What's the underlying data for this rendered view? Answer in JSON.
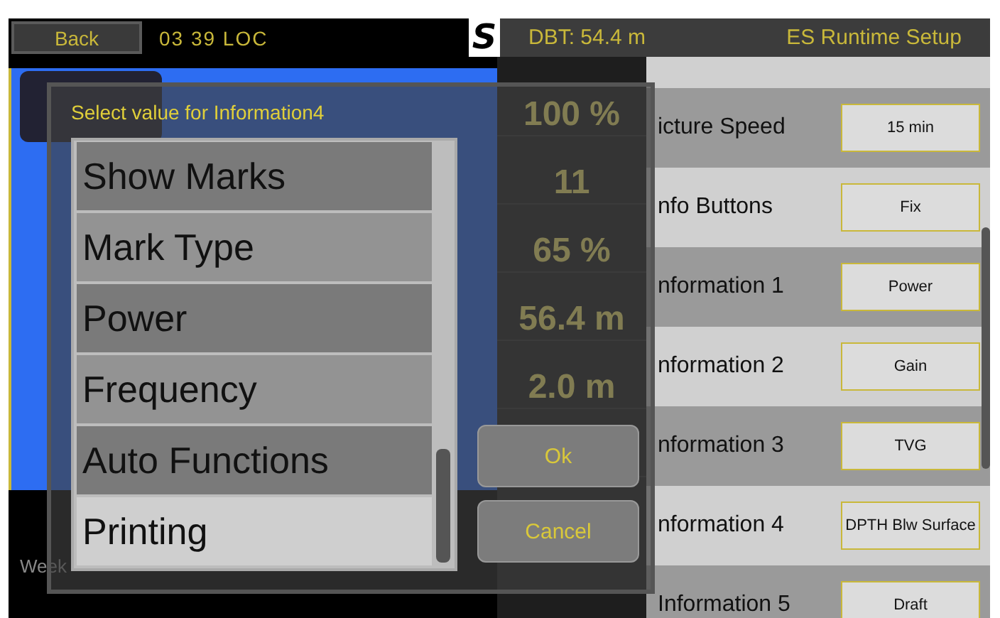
{
  "header": {
    "back": "Back",
    "time": "03 39 LOC",
    "logo": "S",
    "depth": "DBT: 54.4 m",
    "title": "ES Runtime Setup"
  },
  "sonar": {
    "footer": "Week"
  },
  "info_panel": [
    {
      "value": "100 %"
    },
    {
      "value": "11"
    },
    {
      "value": "65 %"
    },
    {
      "value": "56.4 m"
    },
    {
      "value": "2.0 m"
    }
  ],
  "settings": [
    {
      "label": "icture Speed",
      "value": "15 min"
    },
    {
      "label": "nfo Buttons",
      "value": "Fix"
    },
    {
      "label": "nformation 1",
      "value": "Power"
    },
    {
      "label": "nformation 2",
      "value": "Gain"
    },
    {
      "label": "nformation 3",
      "value": "TVG"
    },
    {
      "label": "nformation 4",
      "value": "DPTH Blw Surface"
    },
    {
      "label": "Information 5",
      "value": "Draft"
    }
  ],
  "dialog": {
    "title": "Select value for Information4",
    "options": [
      {
        "label": "Show Marks",
        "selected": false
      },
      {
        "label": "Mark Type",
        "selected": false
      },
      {
        "label": "Power",
        "selected": false
      },
      {
        "label": "Frequency",
        "selected": false
      },
      {
        "label": "Auto Functions",
        "selected": false
      },
      {
        "label": "Printing",
        "selected": true
      }
    ],
    "buttons": [
      "Ok",
      "Cancel"
    ]
  }
}
